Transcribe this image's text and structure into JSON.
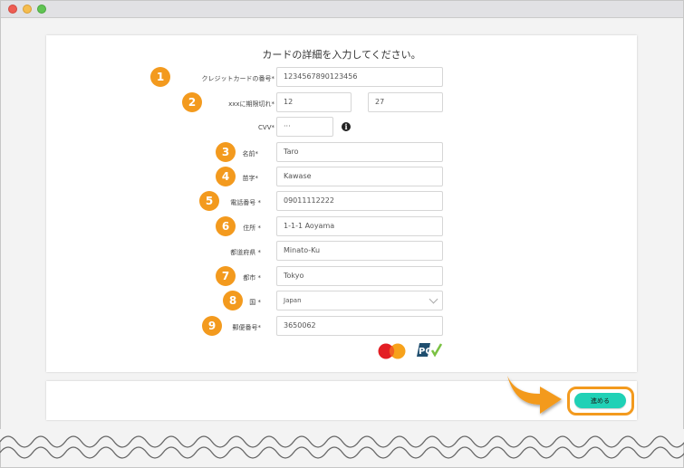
{
  "form": {
    "title": "カードの詳細を入力してください。",
    "rows": [
      {
        "badge": "1",
        "label": "クレジットカードの番号*",
        "value": "1234567890123456"
      },
      {
        "badge": "2",
        "label": "xxxに期限切れ*",
        "month": "12",
        "year": "27"
      },
      {
        "label": "CVV*",
        "value": "···",
        "info_icon": "info-icon"
      },
      {
        "badge": "3",
        "label": "名前*",
        "value": "Taro"
      },
      {
        "badge": "4",
        "label": "苗字*",
        "value": "Kawase"
      },
      {
        "badge": "5",
        "label": "電話番号 *",
        "value": "09011112222"
      },
      {
        "badge": "6",
        "label": "住所 *",
        "value": "1-1-1 Aoyama"
      },
      {
        "label": "都道府県 *",
        "value": "Minato-Ku"
      },
      {
        "badge": "7",
        "label": "都市 *",
        "value": "Tokyo"
      },
      {
        "badge": "8",
        "label": "国 *",
        "value": "Japan"
      },
      {
        "badge": "9",
        "label": "郵便番号*",
        "value": "3650062"
      }
    ],
    "logos": {
      "mastercard": "MasterCard",
      "pci": "PCI"
    }
  },
  "footer": {
    "submit_label": "進める"
  },
  "colors": {
    "accent_orange": "#f39a1e",
    "submit_teal": "#20d1b6"
  }
}
